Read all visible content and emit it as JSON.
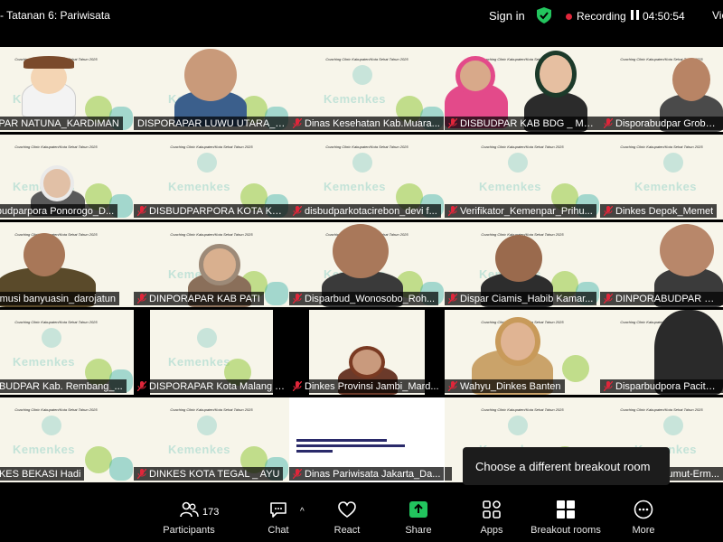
{
  "header": {
    "meeting_title": "- Tatanan 6: Pariwisata",
    "sign_in": "Sign in",
    "recording": "Recording",
    "timer": "04:50:54",
    "view": "View"
  },
  "slide": {
    "coaching_text": "Coaching Clinic Kabupaten/Kota Sehat\nTahun 2025",
    "watermark": "Kemenkes"
  },
  "participants": [
    {
      "name": "DISPAR NATUNA_KARDIMAN"
    },
    {
      "name": "DISPORAPAR LUWU UTARA_LU..."
    },
    {
      "name": "Dinas Kesehatan Kab.Muara..."
    },
    {
      "name": "DISBUDPAR KAB BDG _ MAYA"
    },
    {
      "name": "Disporabudpar Grobog..."
    },
    {
      "name": "Disbudparpora Ponorogo_D..."
    },
    {
      "name": "DISBUDPARPORA KOTA KEDI..."
    },
    {
      "name": "disbudparkotacirebon_devi f..."
    },
    {
      "name": "Verifikator_Kemenpar_Prihu..."
    },
    {
      "name": "Dinkes Depok_Memet"
    },
    {
      "name": "Banmusi banyuasin_darojatun"
    },
    {
      "name": "DINPORAPAR KAB PATI"
    },
    {
      "name": "Disparbud_Wonosobo_Roh..."
    },
    {
      "name": "Dispar Ciamis_Habib Kamar..."
    },
    {
      "name": "DINPORABUDPAR BLOR..."
    },
    {
      "name": "DINBUDPAR Kab. Rembang_..."
    },
    {
      "name": "DISPORAPAR Kota Malang Y..."
    },
    {
      "name": "Dinkes Provinsi Jambi_Mard..."
    },
    {
      "name": "Wahyu_Dinkes Banten"
    },
    {
      "name": "Disparbudpora Pacitan..."
    },
    {
      "name": "DINKES BEKASI Hadi"
    },
    {
      "name": "DINKES KOTA TEGAL _ AYU"
    },
    {
      "name": "Dinas Pariwisata Jakarta_Da..."
    },
    {
      "name": ""
    },
    {
      "name": "Sumut-Erm..."
    }
  ],
  "tooltip": "Choose a different breakout room",
  "toolbar": {
    "participants_label": "Participants",
    "participants_count": "173",
    "chat_label": "Chat",
    "react_label": "React",
    "share_label": "Share",
    "apps_label": "Apps",
    "breakout_label": "Breakout rooms",
    "more_label": "More"
  },
  "colors": {
    "muted_mic": "#e0263a",
    "shield": "#23c55e",
    "share": "#22c55e"
  }
}
